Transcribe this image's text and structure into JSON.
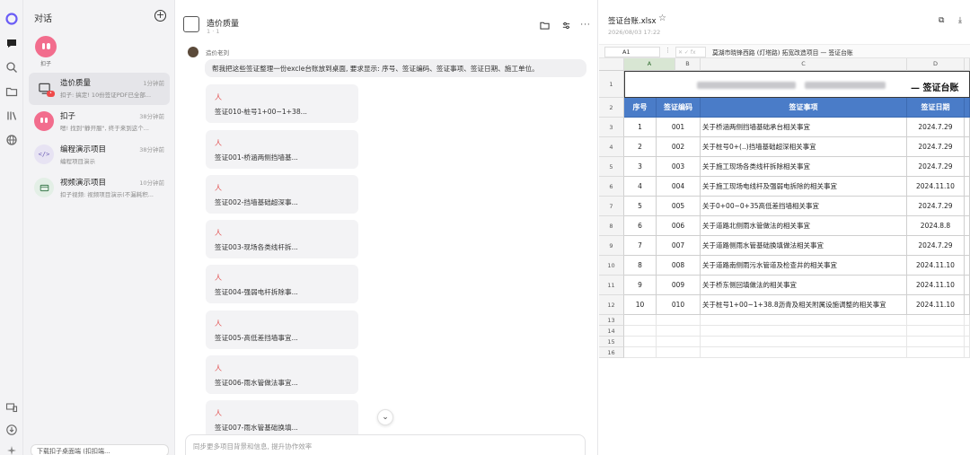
{
  "sidebar": {
    "header": "对话",
    "main_avatar_label": "扣子",
    "conversations": [
      {
        "title": "造价质量",
        "time": "1分钟前",
        "preview": "扣子: 搞定! 10份签证PDF已全部..."
      },
      {
        "title": "扣子",
        "time": "38分钟前",
        "preview": "嗯! 找到\"静开服\", 终于来到这个..."
      },
      {
        "title": "编程演示项目",
        "time": "38分钟前",
        "preview": "编程项目演示"
      },
      {
        "title": "视频演示项目",
        "time": "10分钟前",
        "preview": "扣子视频: 视频项目演示(不漏耗积..."
      }
    ],
    "bottom_promo": "下载扣子桌面端 (扣扣端..."
  },
  "chat": {
    "title": "造价质量",
    "meta": "1 · 1",
    "author": "造价老刘",
    "message": "帮我把这些签证整理一份excle台账放到桌面, 要求显示: 序号、签证编码、签证事项、签证日期、施工单位。",
    "files": [
      "签证010-桩号1+00~1+38...",
      "签证001-桥涵两侧挡墙基...",
      "签证002-挡墙基础超深事...",
      "签证003-现场各类线杆拆...",
      "签证004-强弱电杆拆除事...",
      "签证005-高低差挡墙事宜...",
      "签证006-雨水管做法事宜...",
      "签证007-雨水管基础换填..."
    ],
    "pdf_label": "人",
    "input_placeholder": "同步更多项目背景和信息, 提升协作效率"
  },
  "sheet": {
    "filename": "签证台账.xlsx",
    "date": "2026/08/03 17:22",
    "cell_ref": "A1",
    "formula": "莫湖市晓锋西路 (灯塔路) 拓宽改造项目 — 签证台账",
    "title_suffix": "— 签证台账",
    "columns": [
      "A",
      "B",
      "C",
      "D"
    ],
    "headers": [
      "序号",
      "签证编码",
      "签证事项",
      "签证日期"
    ],
    "rows": [
      {
        "no": "1",
        "code": "001",
        "item": "关于桥涵两侧挡墙基础承台相关事宜",
        "date": "2024.7.29"
      },
      {
        "no": "2",
        "code": "002",
        "item": "关于桩号0+(..)挡墙基础超深相关事宜",
        "date": "2024.7.29"
      },
      {
        "no": "3",
        "code": "003",
        "item": "关于施工现场各类线杆拆除相关事宜",
        "date": "2024.7.29"
      },
      {
        "no": "4",
        "code": "004",
        "item": "关于施工现场电线杆及强弱电拆除的相关事宜",
        "date": "2024.11.10"
      },
      {
        "no": "5",
        "code": "005",
        "item": "关于0+00~0+35高低差挡墙相关事宜",
        "date": "2024.7.29"
      },
      {
        "no": "6",
        "code": "006",
        "item": "关于道路北侧雨水管做法的相关事宜",
        "date": "2024.8.8"
      },
      {
        "no": "7",
        "code": "007",
        "item": "关于道路侧雨水管基础换填做法相关事宜",
        "date": "2024.7.29"
      },
      {
        "no": "8",
        "code": "008",
        "item": "关于道路南侧雨污水管道及检查井的相关事宜",
        "date": "2024.11.10"
      },
      {
        "no": "9",
        "code": "009",
        "item": "关于桥东侧回填做法的相关事宜",
        "date": "2024.11.10"
      },
      {
        "no": "10",
        "code": "010",
        "item": "关于桩号1+00~1+38.8沥青及相关附属设施调整的相关事宜",
        "date": "2024.11.10"
      }
    ],
    "row_numbers": [
      "1",
      "2",
      "3",
      "4",
      "5",
      "6",
      "7",
      "8",
      "9",
      "10",
      "11",
      "12",
      "13",
      "14",
      "15",
      "16"
    ]
  },
  "colors": {
    "header_blue": "#4a7cc8",
    "avatar_pink": "#f26d8d",
    "pdf_red": "#e24b4b"
  }
}
